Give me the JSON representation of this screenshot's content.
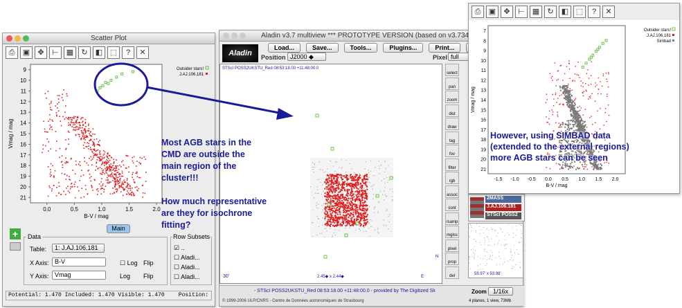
{
  "scatter": {
    "title": "Scatter Plot",
    "ylabel": "Vmag / mag",
    "xlabel": "B-V / mag",
    "legend": [
      "Outsider stars!",
      "J.AJ.106.181"
    ],
    "yticks": [
      "9",
      "10",
      "11",
      "12",
      "13",
      "14",
      "15",
      "16",
      "17",
      "18",
      "19",
      "20",
      "21"
    ],
    "xticks": [
      "0.0",
      "0.5",
      "1.0",
      "1.5",
      "2.0"
    ],
    "main_tab": "Main",
    "data_label": "Data",
    "table_label": "Table:",
    "table_value": "1: J.AJ.106.181",
    "xaxis_label": "X Axis:",
    "xaxis_value": "B-V",
    "yaxis_label": "Y Axis:",
    "yaxis_value": "Vmag",
    "log": "Log",
    "flip": "Flip",
    "row_subsets": "Row Subsets",
    "subset_items": [
      "..",
      "Aladi...",
      "Aladi...",
      "Aladi..."
    ],
    "status": "Potential: 1.470  Included: 1.470  Visible: 1.470",
    "position": "Position:"
  },
  "aladin": {
    "title": "Aladin v3.7 multiview     *** PROTOTYPE VERSION (based on v3.734) ***",
    "menu": [
      "Load...",
      "Save...",
      "Tools...",
      "Plugins...",
      "Print...",
      "Hel"
    ],
    "position_label": "Position",
    "position_value": "J2000",
    "pixel_label": "Pixel",
    "pixel_value": "full",
    "image_header": "STScI POSS2UKSTU_Red 08:53:18.00 +11:48:00.0",
    "scale_label": "30'",
    "size_label": "2.45◆ x 2.44◆",
    "north": "N",
    "east": "E",
    "bottom_status": "- STScI POSS2UKSTU_Red 08:53:18.00 +11:48:00.0 - provided by The Digitized Sk",
    "copyright": "© 1999-2006 ULP/CNRS - Centre de Données astronomiques de Strasbourg",
    "zoom_label": "Zoom",
    "zoom_value": "1/16x",
    "planes": "4 planes, 1 view, 73Mb",
    "side_tools": [
      "select",
      "pan",
      "zoom",
      "dist",
      "draw",
      "tag",
      "fov",
      "filter",
      "rgb",
      "assoc",
      "cont",
      "rsamp",
      "mglss",
      "pixel",
      "prop",
      "del"
    ],
    "layers": [
      "2MASS",
      "J.AJ.106.181",
      "STScI POSS2"
    ],
    "mini_coords": "59.97' x 53.98'"
  },
  "right": {
    "legend": [
      "Outsider stars!",
      "J.AJ.106.181",
      "Simbad"
    ],
    "ylabel": "Vmag / mag",
    "xlabel": "B-V / mag",
    "yticks": [
      "7",
      "8",
      "9",
      "10",
      "11",
      "12",
      "13",
      "14",
      "15",
      "16",
      "17",
      "18",
      "19",
      "20",
      "21"
    ],
    "xticks": [
      "-1.5",
      "-1.0",
      "-0.5",
      "0.0",
      "0.5",
      "1.0",
      "1.5",
      "2.0"
    ]
  },
  "annotations": {
    "left": [
      "Most AGB stars in the",
      "CMD are outside the",
      "main region of the",
      "cluster!!!",
      "",
      "How much representative",
      "are they for isochrone",
      "fitting?"
    ],
    "right": [
      "However, using SIMBAD data",
      "(extended to the external regions)",
      "more AGB stars can be seen"
    ]
  },
  "colors": {
    "red": "#e02020",
    "green": "#6cc24a",
    "gray": "#7a7a7a",
    "annotation": "#1a1a9a"
  }
}
